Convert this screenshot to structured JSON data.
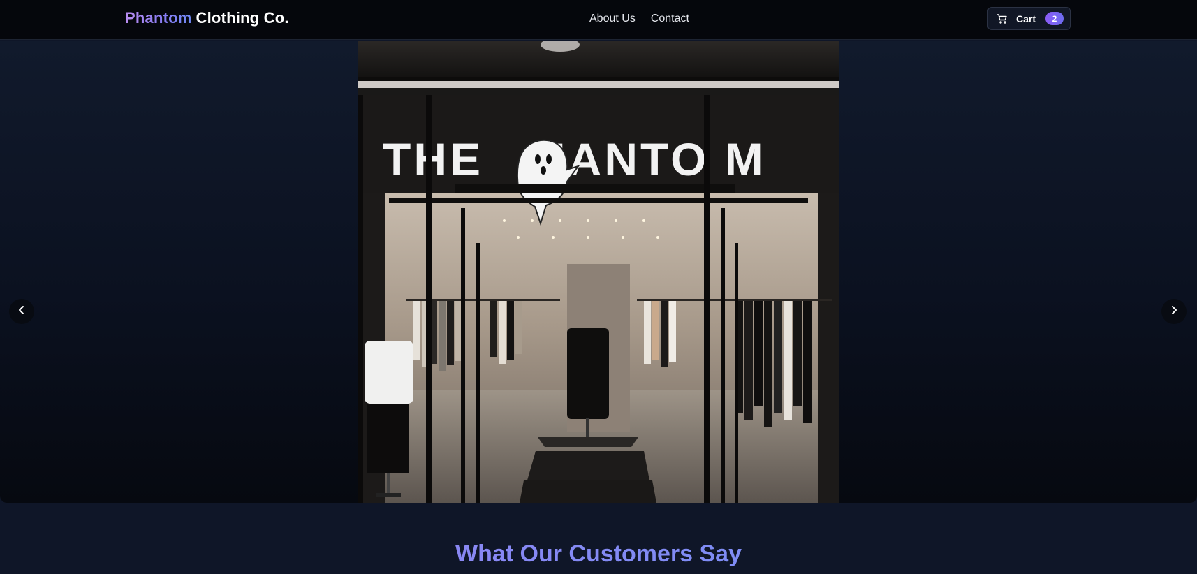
{
  "header": {
    "brand_accent": "Phantom",
    "brand_main": "Clothing Co.",
    "nav": [
      {
        "label": "About Us"
      },
      {
        "label": "Contact"
      }
    ],
    "cart": {
      "label": "Cart",
      "count": "2",
      "icon": "shopping-cart-icon"
    }
  },
  "hero": {
    "slide": {
      "alt": "Storefront of The Phantom clothing store",
      "sign_text": "THE PHANTOM"
    },
    "prev_icon": "chevron-left-icon",
    "next_icon": "chevron-right-icon",
    "slide_count": 8,
    "active_slide": 1
  },
  "testimonials": {
    "title": "What Our Customers Say"
  },
  "colors": {
    "accent_purple": "#8b5cf6",
    "accent_blue": "#6f8af5",
    "header_bg": "#05070c",
    "page_bg": "#0f1628"
  }
}
